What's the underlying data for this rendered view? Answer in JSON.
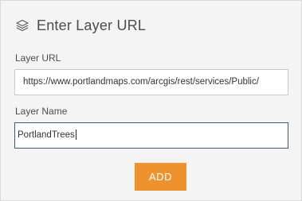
{
  "header": {
    "icon": "layers-icon",
    "title": "Enter Layer URL"
  },
  "layer_url": {
    "label": "Layer URL",
    "value": "https://www.portlandmaps.com/arcgis/rest/services/Public/"
  },
  "layer_name": {
    "label": "Layer Name",
    "value": "PortlandTrees"
  },
  "add_button": {
    "label": "ADD",
    "color": "#ee922f"
  }
}
